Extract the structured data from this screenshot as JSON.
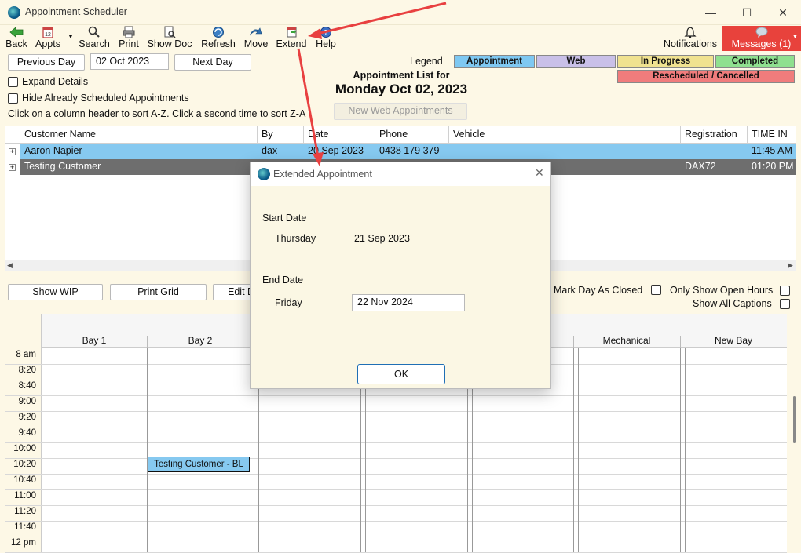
{
  "window": {
    "title": "Appointment Scheduler",
    "minimize": "—",
    "maximize": "☐",
    "close": "✕"
  },
  "toolbar": {
    "back": "Back",
    "appts": "Appts",
    "search": "Search",
    "print": "Print",
    "show_doc": "Show Doc",
    "refresh": "Refresh",
    "move": "Move",
    "extend": "Extend",
    "help": "Help",
    "notifications": "Notifications",
    "messages": "Messages (1)"
  },
  "nav": {
    "prev": "Previous Day",
    "date": "02 Oct 2023",
    "next": "Next Day"
  },
  "options": {
    "expand": "Expand Details",
    "hide": "Hide Already Scheduled Appointments",
    "sort_hint": "Click on a column header to sort A-Z.  Click a second time to sort Z-A"
  },
  "header": {
    "line1": "Appointment List for",
    "line2": "Monday Oct 02, 2023",
    "new_web": "New Web Appointments"
  },
  "legend": {
    "label": "Legend",
    "appointment": "Appointment",
    "web": "Web",
    "in_progress": "In Progress",
    "completed": "Completed",
    "rescheduled": "Rescheduled / Cancelled",
    "colors": {
      "appointment": "#7ec8f2",
      "web": "#c9c0e8",
      "in_progress": "#f0e290",
      "completed": "#8fe08f",
      "rescheduled": "#f07c7c"
    }
  },
  "columns": {
    "name": "Customer Name",
    "by": "By",
    "date": "Date",
    "phone": "Phone",
    "vehicle": "Vehicle",
    "reg": "Registration",
    "time": "TIME IN"
  },
  "rows": [
    {
      "name": "Aaron Napier",
      "by": "dax",
      "date": "20 Sep 2023",
      "phone": "0438 179 379",
      "vehicle": "",
      "reg": "",
      "time": "11:45 AM"
    },
    {
      "name": "Testing Customer",
      "by": "",
      "date": "",
      "phone": "",
      "vehicle": "",
      "reg": "DAX72",
      "time": "01:20 PM"
    }
  ],
  "actions": {
    "wip": "Show WIP",
    "print_grid": "Print Grid",
    "edit": "Edit D"
  },
  "right_opts": {
    "closed": "Mark Day As Closed",
    "open_hours": "Only Show Open Hours",
    "captions": "Show All Captions"
  },
  "bays": {
    "b1": "Bay 1",
    "b2": "Bay 2",
    "mech": "Mechanical",
    "newbay": "New Bay"
  },
  "times": [
    "8 am",
    "8:20",
    "8:40",
    "9:00",
    "9:20",
    "9:40",
    "10:00",
    "10:20",
    "10:40",
    "11:00",
    "11:20",
    "11:40",
    "12 pm"
  ],
  "booking": "Testing Customer - BL",
  "dialog": {
    "title": "Extended Appointment",
    "start_label": "Start Date",
    "start_day": "Thursday",
    "start_date": "21 Sep 2023",
    "end_label": "End Date",
    "end_day": "Friday",
    "end_date": "22 Nov 2024",
    "ok": "OK"
  }
}
